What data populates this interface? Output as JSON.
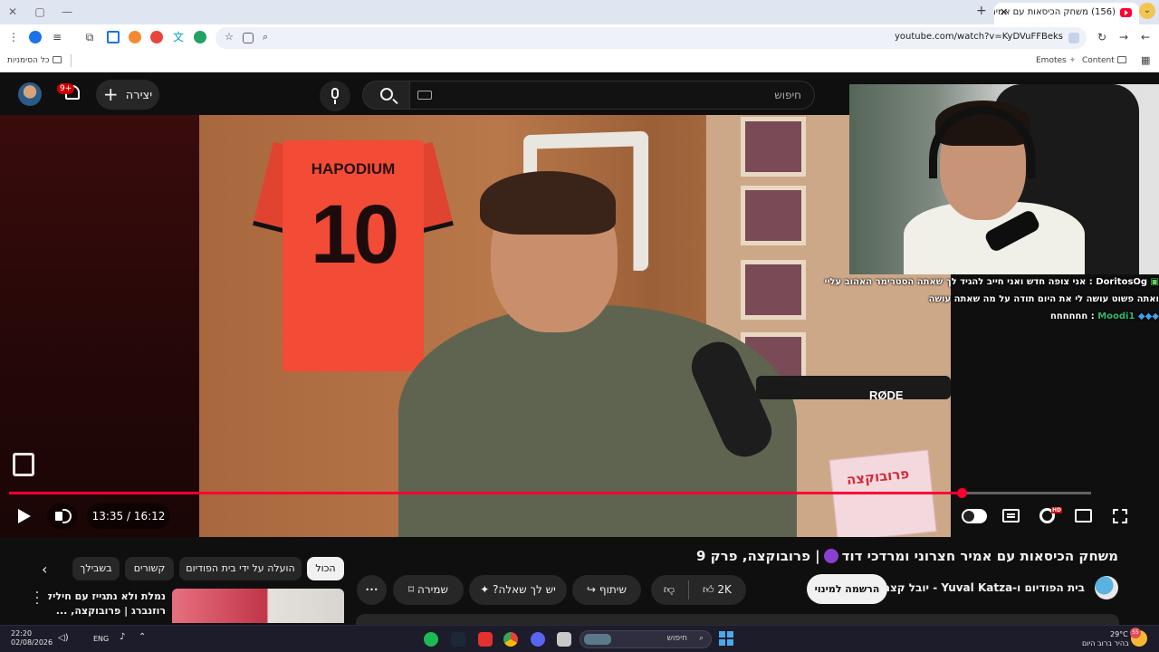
{
  "browser": {
    "tab_title": "(156) משחק הכיסאות עם אמיר",
    "url": "youtube.com/watch?v=KyDVuFFBeks",
    "bookmarks": {
      "all_bookmarks": "כל הסימניות",
      "emotes": "Emotes",
      "content": "Content"
    }
  },
  "yt_header": {
    "search_placeholder": "חיפוש",
    "create_label": "יצירה",
    "notification_count": "9+"
  },
  "player": {
    "jersey_name": "HAPODIUM",
    "jersey_number": "10",
    "mic_brand": "RØDE",
    "book_title": "פרובוקצה",
    "time": "13:35 / 16:12",
    "progress": 0.88,
    "buffered": 1.0,
    "hd_badge": "HD"
  },
  "chat": [
    {
      "user": "DoritosOg",
      "text": "אני צופה חדש ואני חייב להגיד לך שאתה הסטרימר האהוב עליי",
      "color": "#ffffff"
    },
    {
      "user": "",
      "text": "ואתה פשוט עושה לי את היום תודה על מה שאתה עושה",
      "color": "#ffffff"
    },
    {
      "user": "Moodi1",
      "text": "חחחחחח",
      "color": "#2fb871"
    }
  ],
  "video": {
    "title_pre": "משחק הכיסאות עם אמיר חצרוני ומרדכי דוד",
    "title_post": "| פרובוקצה, פרק 9",
    "channel": "בית הפודיום ו-Yuval Katza - יובל קצה",
    "subscribe": "הרשמה למינוי",
    "likes": "2K",
    "share": "שיתוף",
    "ask": "יש לך שאלה?",
    "save": "שמירה",
    "more": "•••"
  },
  "chips": {
    "all": "הכול",
    "uploaded_by": "הועלה על ידי בית הפודיום",
    "related": "קשורים",
    "for_you": "בשבילך"
  },
  "recommendation": {
    "title_line1": "נמלת ולא נתגייז עם חיליק",
    "title_line2": "רוזנברג | פרובוקצה, ..."
  },
  "taskbar": {
    "time": "22:20",
    "date": "02/08/2026",
    "lang": "ENG",
    "search": "חיפוש",
    "temp": "29°C",
    "weather_desc": "בהיר ברוב היום",
    "weather_badge": "55"
  },
  "colors": {
    "accent": "#ff0033",
    "background": "#0f0f0f",
    "chip_bg": "#272727"
  }
}
